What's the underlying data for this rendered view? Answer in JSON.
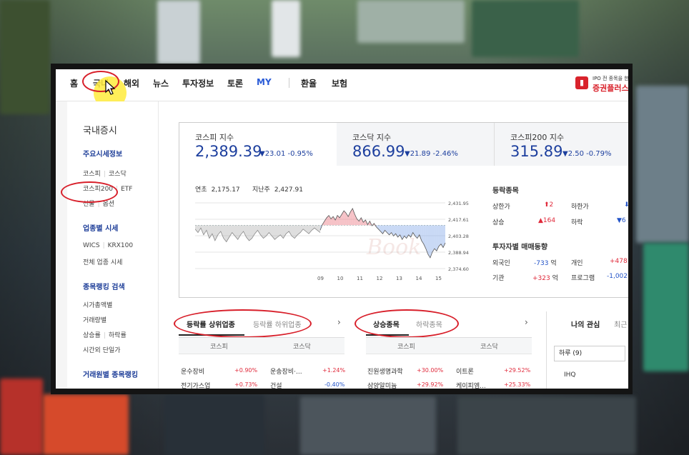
{
  "nav": {
    "items": [
      "홈",
      "국내",
      "해외",
      "뉴스",
      "투자정보",
      "토론",
      "MY",
      "환율",
      "보험"
    ],
    "promo_small": "IPO 전 종목을 한",
    "promo_big": "증권플러스"
  },
  "sidebar": {
    "title": "국내증시",
    "sec1": "주요시세정보",
    "l1a": "코스피",
    "l1b": "코스닥",
    "l2a": "코스피200",
    "l2b": "ETF",
    "l3a": "선물",
    "l3b": "옵션",
    "sec2": "업종별 시세",
    "l4a": "WICS",
    "l4b": "KRX100",
    "l5": "전체 업종 시세",
    "sec3": "종목랭킹 검색",
    "l6": "시가총액별",
    "l7": "거래량별",
    "l8a": "상승률",
    "l8b": "하락률",
    "l9": "시간외 단일가",
    "sec4": "거래원별 종목랭킹"
  },
  "indices": [
    {
      "name": "코스피 지수",
      "value": "2,389.39",
      "change": "▼23.01",
      "pct": "-0.95%"
    },
    {
      "name": "코스닥 지수",
      "value": "866.99",
      "change": "▼21.89",
      "pct": "-2.46%"
    },
    {
      "name": "코스피200 지수",
      "value": "315.89",
      "change": "▼2.50",
      "pct": "-0.79%"
    }
  ],
  "chart_info": {
    "year_start_label": "연초",
    "year_start": "2,175.17",
    "last_week_label": "지난주",
    "last_week": "2,427.91"
  },
  "chart_data": {
    "type": "area",
    "x": [
      "09",
      "10",
      "11",
      "12",
      "13",
      "14",
      "15"
    ],
    "yticks": [
      "2,431.95",
      "2,417.61",
      "2,403.28",
      "2,388.94",
      "2,374.60"
    ],
    "ylim": [
      2374.6,
      2431.95
    ],
    "baseline": 2412.4,
    "pre_open": [
      2409,
      2406,
      2410,
      2404,
      2408,
      2401,
      2405,
      2399,
      2404,
      2407,
      2401,
      2398,
      2402,
      2406,
      2403,
      2400,
      2404,
      2407,
      2402,
      2399,
      2401,
      2405,
      2408,
      2404,
      2401,
      2403,
      2406,
      2403,
      2400,
      2402,
      2404,
      2401,
      2405,
      2407,
      2403,
      2401,
      2404,
      2406,
      2409,
      2407,
      2405,
      2408,
      2410,
      2408,
      2406
    ],
    "values": [
      2408,
      2413,
      2416,
      2419,
      2421,
      2418,
      2420,
      2417,
      2421,
      2419,
      2422,
      2425,
      2423,
      2420,
      2424,
      2427,
      2422,
      2418,
      2416,
      2419,
      2415,
      2417,
      2413,
      2416,
      2412,
      2414,
      2411,
      2409,
      2407,
      2405,
      2408,
      2406,
      2404,
      2406,
      2403,
      2405,
      2402,
      2404,
      2400,
      2403,
      2401,
      2404,
      2402,
      2406,
      2403,
      2401,
      2404,
      2399,
      2396,
      2392,
      2387,
      2384,
      2389,
      2392,
      2390,
      2394,
      2396,
      2393,
      2397
    ]
  },
  "movers": {
    "title": "등락종목",
    "upper_limit_label": "상한가",
    "upper_limit": "2",
    "lower_limit_label": "하한가",
    "rise_label": "상승",
    "rise": "164",
    "fall_label": "하락",
    "fall": "6"
  },
  "investors": {
    "title": "투자자별 매매동향",
    "foreign_label": "외국인",
    "foreign": "-733",
    "unit": "억",
    "individual_label": "개인",
    "individual": "+478",
    "institution_label": "기관",
    "institution": "+323",
    "program_label": "프로그램",
    "program": "-1,002"
  },
  "sector_tabs": {
    "on": "등락률 상위업종",
    "off": "등락률 하위업종",
    "col1": "코스피",
    "col2": "코스닥"
  },
  "sector_rows": [
    {
      "n1": "운수장비",
      "v1": "+0.90%",
      "n2": "운송장비·...",
      "v2": "+1.24%"
    },
    {
      "n1": "전기가스업",
      "v1": "+0.73%",
      "n2": "건설",
      "v2": "-0.40%"
    }
  ],
  "stock_tabs": {
    "on": "상승종목",
    "off": "하락종목",
    "col1": "코스피",
    "col2": "코스닥"
  },
  "stock_rows": [
    {
      "n1": "진원생명과학",
      "v1": "+30.00%",
      "n2": "이트론",
      "v2": "+29.52%"
    },
    {
      "n1": "삼양알미늄",
      "v1": "+29.92%",
      "n2": "케이피엠...",
      "v2": "+25.33%"
    }
  ],
  "my": {
    "tab1": "나의 관심",
    "tab2": "최근",
    "select": "하루 (9)",
    "item": "IHQ"
  },
  "watermark": "Book"
}
